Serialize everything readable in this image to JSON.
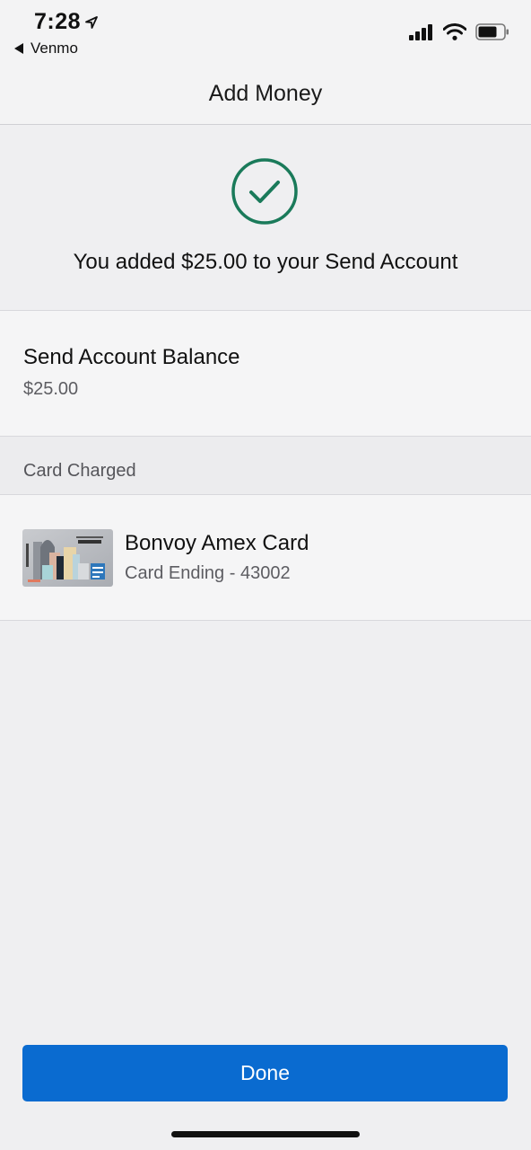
{
  "status_bar": {
    "time": "7:28",
    "back_app": "Venmo",
    "icons": [
      "location-arrow-icon",
      "cellular-signal-icon",
      "wifi-icon",
      "battery-icon"
    ]
  },
  "nav": {
    "title": "Add Money"
  },
  "confirmation": {
    "icon": "check-circle-icon",
    "message": "You added $25.00 to your Send Account",
    "accent_color": "#1a7a5a"
  },
  "balance": {
    "label": "Send Account Balance",
    "value": "$25.00"
  },
  "card_section": {
    "header": "Card Charged",
    "card_name": "Bonvoy Amex Card",
    "card_detail": "Card Ending - 43002",
    "card_image_icon": "amex-card-icon"
  },
  "actions": {
    "done_label": "Done",
    "done_color": "#0a6bd0"
  }
}
